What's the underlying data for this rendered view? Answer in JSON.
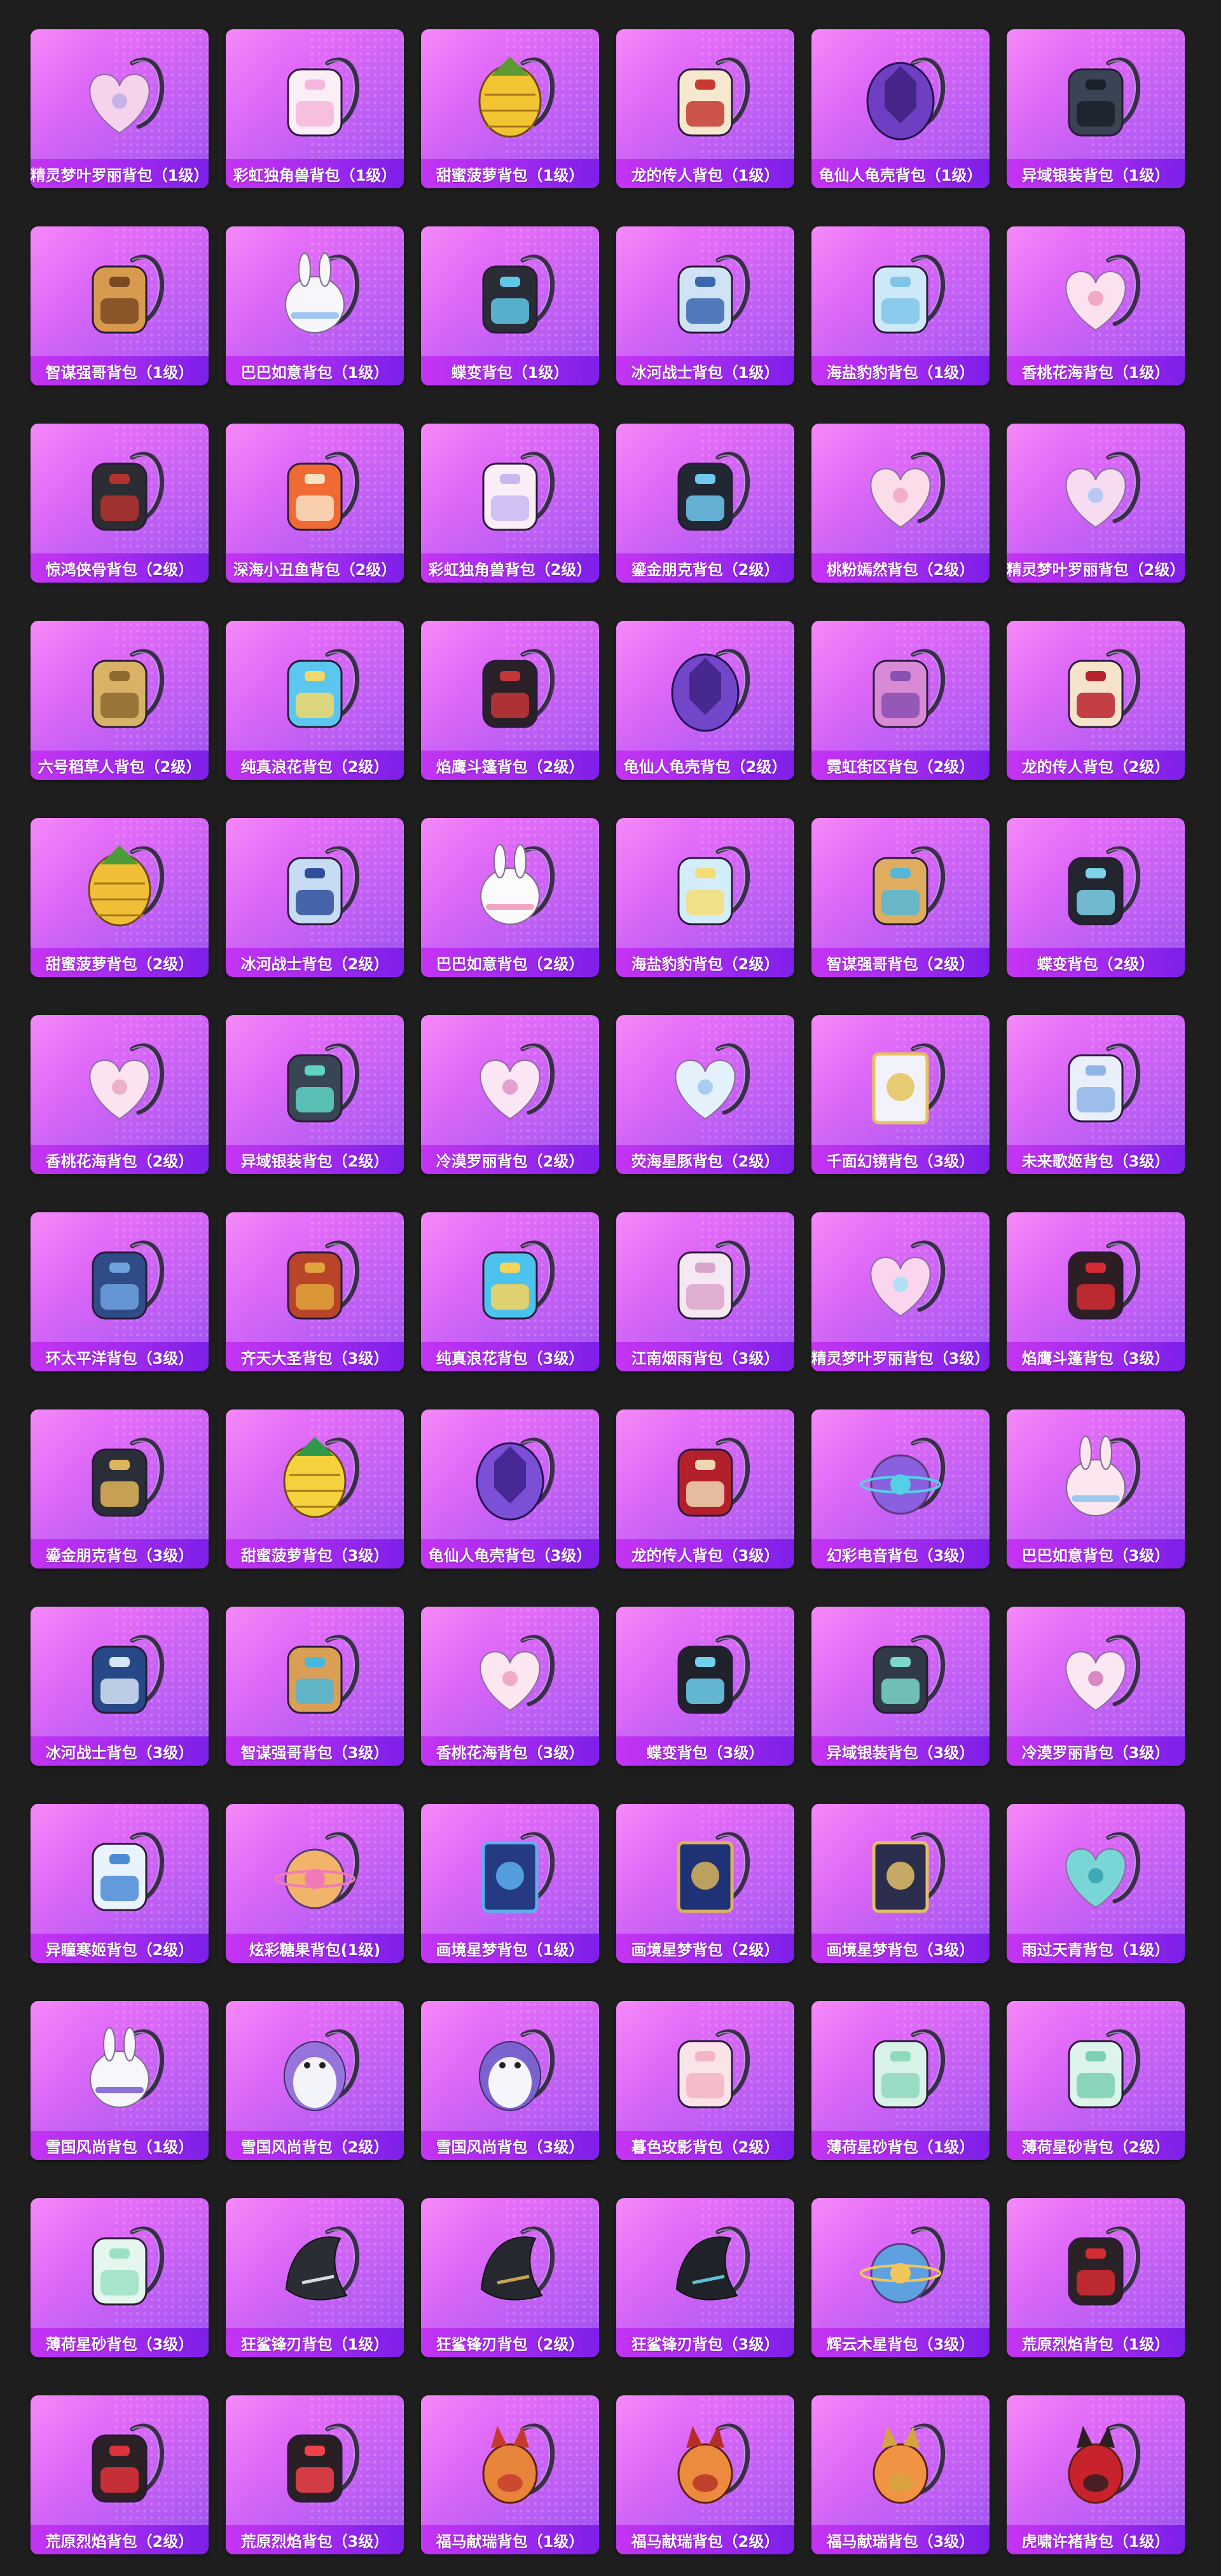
{
  "items": [
    {
      "label": "精灵梦叶罗丽背包（1级）",
      "icon": "heart-fairy-backpack-icon",
      "c1": "#f6d3ec",
      "c2": "#c8b3e8"
    },
    {
      "label": "彩虹独角兽背包（1级）",
      "icon": "unicorn-backpack-icon",
      "c1": "#fbeef7",
      "c2": "#f4b6dc"
    },
    {
      "label": "甜蜜菠萝背包（1级）",
      "icon": "pineapple-backpack-icon",
      "c1": "#f2c433",
      "c2": "#5d9a34"
    },
    {
      "label": "龙的传人背包（1级）",
      "icon": "dragon-heir-backpack-icon",
      "c1": "#f6e7cf",
      "c2": "#c63a30"
    },
    {
      "label": "龟仙人龟壳背包（1级）",
      "icon": "turtle-shell-backpack-icon",
      "c1": "#6e3fc2",
      "c2": "#3b1f79"
    },
    {
      "label": "异域银装背包（1级）",
      "icon": "exotic-silver-backpack-icon",
      "c1": "#3b4454",
      "c2": "#1b2029"
    },
    {
      "label": "智谋强哥背包（1级）",
      "icon": "strong-bro-backpack-icon",
      "c1": "#d89a4e",
      "c2": "#7a4a22"
    },
    {
      "label": "巴巴如意背包（1级）",
      "icon": "bunny-backpack-icon",
      "c1": "#f7f7fb",
      "c2": "#9fc4f0"
    },
    {
      "label": "蝶变背包（1级）",
      "icon": "butterfly-backpack-icon",
      "c1": "#2b2d36",
      "c2": "#5fc7e6"
    },
    {
      "label": "冰河战士背包（1级）",
      "icon": "glacier-warrior-backpack-icon",
      "c1": "#cfe3f4",
      "c2": "#3a67b0"
    },
    {
      "label": "海盐豹豹背包（1级）",
      "icon": "sea-salt-seal-backpack-icon",
      "c1": "#cde9f8",
      "c2": "#7fc5ea"
    },
    {
      "label": "香桃花海背包（1级）",
      "icon": "peach-blossom-backpack-icon",
      "c1": "#fbe2ee",
      "c2": "#f2a7c4"
    },
    {
      "label": "惊鸿侠骨背包（2级）",
      "icon": "swift-hero-backpack-icon",
      "c1": "#2c2c33",
      "c2": "#b4332f"
    },
    {
      "label": "深海小丑鱼背包（2级）",
      "icon": "clownfish-backpack-icon",
      "c1": "#ef6b33",
      "c2": "#fbe1c4"
    },
    {
      "label": "彩虹独角兽背包（2级）",
      "icon": "unicorn-backpack-icon",
      "c1": "#fbeef7",
      "c2": "#c9b7f2"
    },
    {
      "label": "鎏金朋克背包（2级）",
      "icon": "gilded-punk-backpack-icon",
      "c1": "#222833",
      "c2": "#6ec8f0"
    },
    {
      "label": "桃粉嫣然背包（2级）",
      "icon": "peach-pink-backpack-icon",
      "c1": "#fbdde9",
      "c2": "#f3afc6"
    },
    {
      "label": "精灵梦叶罗丽背包（2级）",
      "icon": "heart-fairy-backpack-icon",
      "c1": "#f7dbf1",
      "c2": "#b7c9f1"
    },
    {
      "label": "六号稻草人背包（2级）",
      "icon": "scarecrow-backpack-icon",
      "c1": "#d7b267",
      "c2": "#8e6a31"
    },
    {
      "label": "纯真浪花背包（2级）",
      "icon": "wave-drink-backpack-icon",
      "c1": "#5bc6ee",
      "c2": "#f2d86a"
    },
    {
      "label": "焰鹰斗篷背包（2级）",
      "icon": "flame-hawk-backpack-icon",
      "c1": "#2a2027",
      "c2": "#c4363a"
    },
    {
      "label": "龟仙人龟壳背包（2级）",
      "icon": "turtle-shell-backpack-icon",
      "c1": "#7247c9",
      "c2": "#3c2180"
    },
    {
      "label": "霓虹街区背包（2级）",
      "icon": "neon-block-backpack-icon",
      "c1": "#d98ad7",
      "c2": "#8a4fb2"
    },
    {
      "label": "龙的传人背包（2级）",
      "icon": "dragon-heir-backpack-icon",
      "c1": "#f6e3cc",
      "c2": "#b9232d"
    },
    {
      "label": "甜蜜菠萝背包（2级）",
      "icon": "pineapple-backpack-icon",
      "c1": "#f0bf35",
      "c2": "#4e9b39"
    },
    {
      "label": "冰河战士背包（2级）",
      "icon": "glacier-warrior-backpack-icon",
      "c1": "#c7dcf2",
      "c2": "#2f4f9c"
    },
    {
      "label": "巴巴如意背包（2级）",
      "icon": "bunny-backpack-icon",
      "c1": "#fbfbfd",
      "c2": "#f3a6c0"
    },
    {
      "label": "海盐豹豹背包（2级）",
      "icon": "sea-salt-seal-backpack-icon",
      "c1": "#d4edfa",
      "c2": "#f4dd76"
    },
    {
      "label": "智谋强哥背包（2级）",
      "icon": "strong-bro-backpack-icon",
      "c1": "#e0ad60",
      "c2": "#54b7d8"
    },
    {
      "label": "蝶变背包（2级）",
      "icon": "butterfly-backpack-icon",
      "c1": "#23262f",
      "c2": "#7fd3ea"
    },
    {
      "label": "香桃花海背包（2级）",
      "icon": "peach-blossom-backpack-icon",
      "c1": "#fbe3ef",
      "c2": "#eeb0c8"
    },
    {
      "label": "异域银装背包（2级）",
      "icon": "exotic-silver-backpack-icon",
      "c1": "#384553",
      "c2": "#5fd3c4"
    },
    {
      "label": "冷漠罗丽背包（2级）",
      "icon": "cold-loli-backpack-icon",
      "c1": "#fbe6f4",
      "c2": "#e6a0cf"
    },
    {
      "label": "荧海星豚背包（2级）",
      "icon": "star-dolphin-backpack-icon",
      "c1": "#e4f1fb",
      "c2": "#a9cdf2"
    },
    {
      "label": "千面幻镜背包（3级）",
      "icon": "mirror-backpack-icon",
      "c1": "#f2f3fa",
      "c2": "#e5c35a"
    },
    {
      "label": "未来歌姬背包（3级）",
      "icon": "future-diva-backpack-icon",
      "c1": "#e9f0fb",
      "c2": "#8fb4e6"
    },
    {
      "label": "环太平洋背包（3级）",
      "icon": "pacific-rim-backpack-icon",
      "c1": "#2f4c86",
      "c2": "#6fa3e0"
    },
    {
      "label": "齐天大圣背包（3级）",
      "icon": "monkey-king-backpack-icon",
      "c1": "#b8452a",
      "c2": "#e1a43a"
    },
    {
      "label": "纯真浪花背包（3级）",
      "icon": "wave-drink-backpack-icon",
      "c1": "#4cc2ee",
      "c2": "#f7d45a"
    },
    {
      "label": "江南烟雨背包（3级）",
      "icon": "jiangnan-rain-backpack-icon",
      "c1": "#f5e8f2",
      "c2": "#d9a4cb"
    },
    {
      "label": "精灵梦叶罗丽背包（3级）",
      "icon": "heart-fairy-backpack-icon",
      "c1": "#f9d6ee",
      "c2": "#b0e0f2"
    },
    {
      "label": "焰鹰斗篷背包（3级）",
      "icon": "flame-hawk-backpack-icon",
      "c1": "#2d1e24",
      "c2": "#d52b34"
    },
    {
      "label": "鎏金朋克背包（3级）",
      "icon": "gilded-punk-backpack-icon",
      "c1": "#2a2e38",
      "c2": "#e0b45a"
    },
    {
      "label": "甜蜜菠萝背包（3级）",
      "icon": "pineapple-backpack-icon",
      "c1": "#f4d23e",
      "c2": "#2f9a4a"
    },
    {
      "label": "龟仙人龟壳背包（3级）",
      "icon": "turtle-shell-backpack-icon",
      "c1": "#7b4fd6",
      "c2": "#3a1f84"
    },
    {
      "label": "龙的传人背包（3级）",
      "icon": "dragon-heir-backpack-icon",
      "c1": "#b3202c",
      "c2": "#f0d7b2"
    },
    {
      "label": "幻彩电音背包（3级）",
      "icon": "electro-sound-backpack-icon",
      "c1": "#8a5fe0",
      "c2": "#54d0e4"
    },
    {
      "label": "巴巴如意背包（3级）",
      "icon": "bunny-backpack-icon",
      "c1": "#fde6ef",
      "c2": "#9bc9f2"
    },
    {
      "label": "冰河战士背包（3级）",
      "icon": "glacier-warrior-backpack-icon",
      "c1": "#274887",
      "c2": "#d6e5f6"
    },
    {
      "label": "智谋强哥背包（3级）",
      "icon": "strong-bro-backpack-icon",
      "c1": "#d99f55",
      "c2": "#4bb6db"
    },
    {
      "label": "香桃花海背包（3级）",
      "icon": "peach-blossom-backpack-icon",
      "c1": "#fce6f0",
      "c2": "#f1a9c6"
    },
    {
      "label": "蝶变背包（3级）",
      "icon": "butterfly-backpack-icon",
      "c1": "#1f222b",
      "c2": "#6fd0ef"
    },
    {
      "label": "异域银装背包（3级）",
      "icon": "exotic-silver-backpack-icon",
      "c1": "#2f3a46",
      "c2": "#7ad7c9"
    },
    {
      "label": "冷漠罗丽背包（3级）",
      "icon": "cold-loli-backpack-icon",
      "c1": "#fbe7f3",
      "c2": "#d989c2"
    },
    {
      "label": "异瞳寒姬背包（2级）",
      "icon": "ice-maiden-backpack-icon",
      "c1": "#e9f3fb",
      "c2": "#4a8ad6"
    },
    {
      "label": "炫彩糖果背包(1级)",
      "icon": "donut-backpack-icon",
      "c1": "#f2b36a",
      "c2": "#f07ab8"
    },
    {
      "label": "画境星梦背包（1级）",
      "icon": "star-dream-book-backpack-icon",
      "c1": "#253a82",
      "c2": "#5bb0ec"
    },
    {
      "label": "画境星梦背包（2级）",
      "icon": "star-dream-book-backpack-icon",
      "c1": "#1f3275",
      "c2": "#d8b45c"
    },
    {
      "label": "画境星梦背包（3级）",
      "icon": "star-dream-frame-backpack-icon",
      "c1": "#2a2e4c",
      "c2": "#e2be68"
    },
    {
      "label": "雨过天青背包（1级）",
      "icon": "celadon-pendant-backpack-icon",
      "c1": "#7ad6d6",
      "c2": "#3fa8b6"
    },
    {
      "label": "雪国风尚背包（1级）",
      "icon": "snow-bunny-backpack-icon",
      "c1": "#f6f6fb",
      "c2": "#8a72d8"
    },
    {
      "label": "雪国风尚背包（2级）",
      "icon": "snow-penguin-backpack-icon",
      "c1": "#f3f3fa",
      "c2": "#9574dc"
    },
    {
      "label": "雪国风尚背包（3级）",
      "icon": "snow-penguin-backpack-icon",
      "c1": "#f5f5fb",
      "c2": "#7a63cf"
    },
    {
      "label": "暮色玫影背包（2级）",
      "icon": "dusk-rose-doll-backpack-icon",
      "c1": "#fbe3ea",
      "c2": "#f2b5c5"
    },
    {
      "label": "薄荷星砂背包（1级）",
      "icon": "mint-star-backpack-icon",
      "c1": "#d8f2e8",
      "c2": "#8fd9bd"
    },
    {
      "label": "薄荷星砂背包（2级）",
      "icon": "mint-star-backpack-icon",
      "c1": "#dcf4ea",
      "c2": "#7dd0b3"
    },
    {
      "label": "薄荷星砂背包（3级）",
      "icon": "mint-star-backpack-icon",
      "c1": "#e4f6ee",
      "c2": "#9ce0c4"
    },
    {
      "label": "狂鲨锋刃背包（1级）",
      "icon": "shark-blade-backpack-icon",
      "c1": "#2a2d34",
      "c2": "#d8dce2"
    },
    {
      "label": "狂鲨锋刃背包（2级）",
      "icon": "shark-blade-backpack-icon",
      "c1": "#25282f",
      "c2": "#c9a34e"
    },
    {
      "label": "狂鲨锋刃背包（3级）",
      "icon": "shark-blade-backpack-icon",
      "c1": "#1f2229",
      "c2": "#5fc4d8"
    },
    {
      "label": "辉云木星背包（3级）",
      "icon": "jupiter-backpack-icon",
      "c1": "#5fa0e0",
      "c2": "#f0c65a"
    },
    {
      "label": "荒原烈焰背包（1级）",
      "icon": "wasteland-flame-backpack-icon",
      "c1": "#2b2227",
      "c2": "#d62c33"
    },
    {
      "label": "荒原烈焰背包（2级）",
      "icon": "wasteland-flame-backpack-icon",
      "c1": "#2a2026",
      "c2": "#e0323a"
    },
    {
      "label": "荒原烈焰背包（3级）",
      "icon": "wasteland-flame-backpack-icon",
      "c1": "#2a1f25",
      "c2": "#f04248"
    },
    {
      "label": "福马献瑞背包（1级）",
      "icon": "lucky-horse-backpack-icon",
      "c1": "#e8843a",
      "c2": "#c43a2e"
    },
    {
      "label": "福马献瑞背包（2级）",
      "icon": "lucky-horse-backpack-icon",
      "c1": "#ec8a3d",
      "c2": "#b52e26"
    },
    {
      "label": "福马献瑞背包（3级）",
      "icon": "lucky-horse-backpack-icon",
      "c1": "#f09444",
      "c2": "#d4a43e"
    },
    {
      "label": "虎啸许褚背包（1级）",
      "icon": "tiger-roar-backpack-icon",
      "c1": "#c8232c",
      "c2": "#2a1e22"
    }
  ]
}
